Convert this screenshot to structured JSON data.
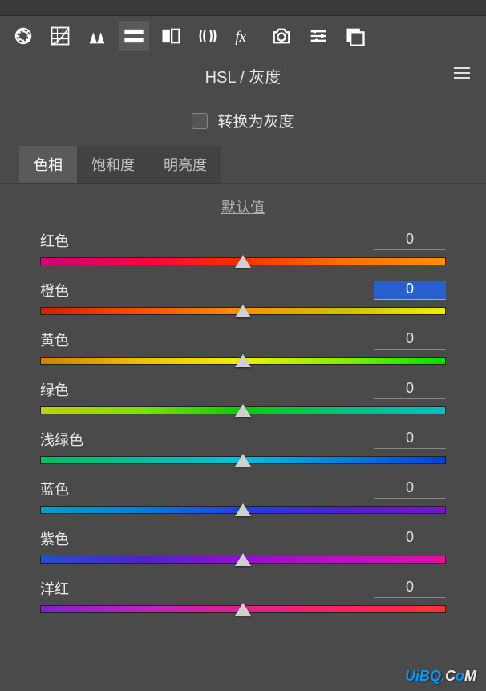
{
  "panel": {
    "title": "HSL / 灰度"
  },
  "grayscale": {
    "label": "转换为灰度",
    "checked": false
  },
  "tabs": {
    "hue": "色相",
    "saturation": "饱和度",
    "luminance": "明亮度"
  },
  "default_link": "默认值",
  "sliders": [
    {
      "label": "红色",
      "value": "0",
      "gradient": "grad-red",
      "active": false
    },
    {
      "label": "橙色",
      "value": "0",
      "gradient": "grad-orange",
      "active": true
    },
    {
      "label": "黄色",
      "value": "0",
      "gradient": "grad-yellow",
      "active": false
    },
    {
      "label": "绿色",
      "value": "0",
      "gradient": "grad-green",
      "active": false
    },
    {
      "label": "浅绿色",
      "value": "0",
      "gradient": "grad-aqua",
      "active": false
    },
    {
      "label": "蓝色",
      "value": "0",
      "gradient": "grad-blue",
      "active": false
    },
    {
      "label": "紫色",
      "value": "0",
      "gradient": "grad-purple",
      "active": false
    },
    {
      "label": "洋红",
      "value": "0",
      "gradient": "grad-magenta",
      "active": false
    }
  ],
  "watermark": "UiBQ.CoM"
}
